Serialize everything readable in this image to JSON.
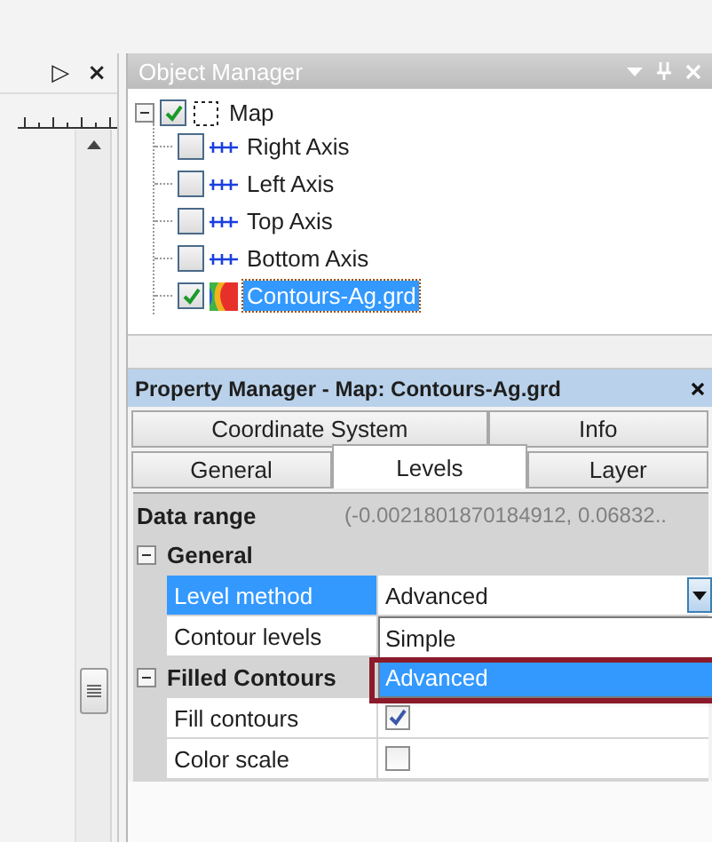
{
  "left_pane": {
    "buttons": [
      "▷",
      "×"
    ]
  },
  "object_manager": {
    "title": "Object Manager",
    "tree": [
      {
        "label": "Map",
        "kind": "frame",
        "checked": true,
        "expanded": true,
        "selected": false,
        "children": [
          {
            "label": "Right Axis",
            "kind": "axis",
            "checked": false,
            "selected": false
          },
          {
            "label": "Left Axis",
            "kind": "axis",
            "checked": false,
            "selected": false
          },
          {
            "label": "Top Axis",
            "kind": "axis",
            "checked": false,
            "selected": false
          },
          {
            "label": "Bottom Axis",
            "kind": "axis",
            "checked": false,
            "selected": false
          },
          {
            "label": "Contours-Ag.grd",
            "kind": "contour",
            "checked": true,
            "selected": true
          }
        ]
      }
    ]
  },
  "property_manager": {
    "title": "Property Manager - Map: Contours-Ag.grd",
    "tab_rows": [
      [
        {
          "label": "Coordinate System",
          "selected": false
        },
        {
          "label": "Info",
          "selected": false
        }
      ],
      [
        {
          "label": "General",
          "selected": false
        },
        {
          "label": "Levels",
          "selected": true
        },
        {
          "label": "Layer",
          "selected": false
        }
      ]
    ],
    "summary": {
      "label": "Data range",
      "value": "(-0.0021801870184912, 0.06832.."
    },
    "sections": [
      {
        "title": "General",
        "expanded": true,
        "rows": [
          {
            "kind": "select",
            "label": "Level method",
            "value": "Advanced",
            "selected": true
          },
          {
            "kind": "text",
            "label": "Contour levels",
            "selected": false
          }
        ]
      },
      {
        "title": "Filled Contours",
        "expanded": true,
        "rows": [
          {
            "kind": "checkbox",
            "label": "Fill contours",
            "checked": true,
            "selected": false
          },
          {
            "kind": "checkbox",
            "label": "Color scale",
            "checked": false,
            "selected": false
          }
        ]
      }
    ],
    "dropdown": {
      "options": [
        {
          "label": "Simple",
          "selected": false
        },
        {
          "label": "Advanced",
          "selected": true
        }
      ]
    }
  }
}
